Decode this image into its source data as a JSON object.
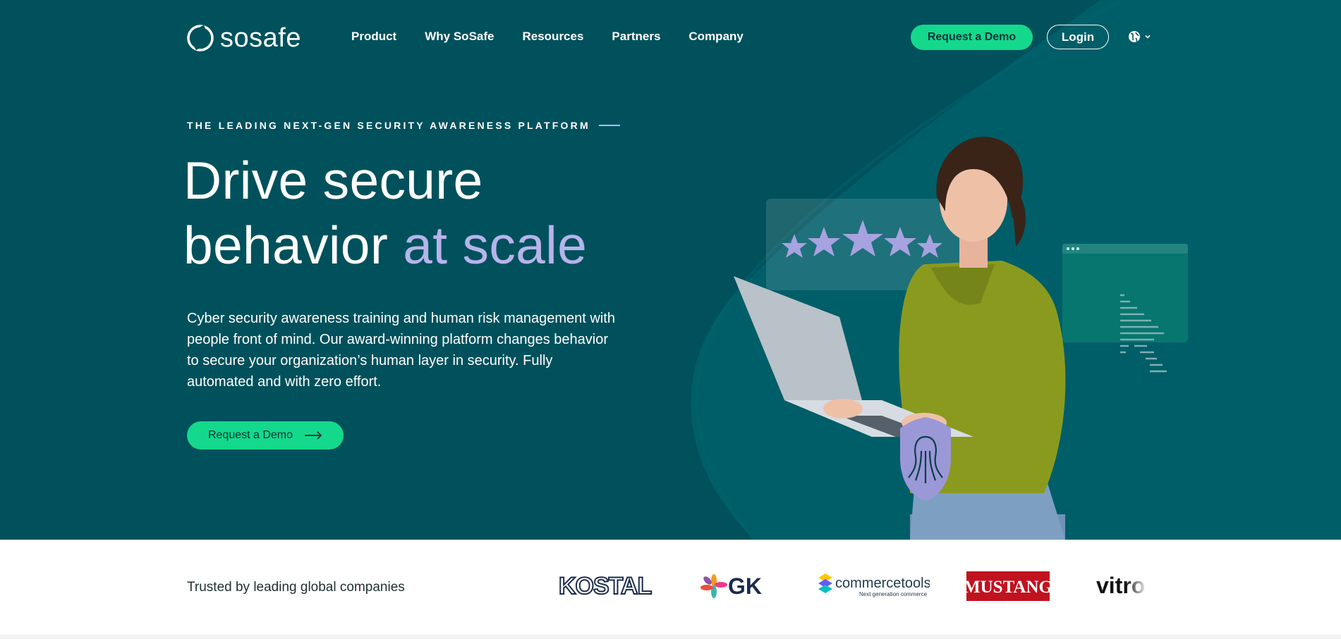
{
  "brand": {
    "name": "sosafe"
  },
  "nav": {
    "links": [
      {
        "label": "Product"
      },
      {
        "label": "Why SoSafe"
      },
      {
        "label": "Resources"
      },
      {
        "label": "Partners"
      },
      {
        "label": "Company"
      }
    ],
    "demo_label": "Request a Demo",
    "login_label": "Login",
    "language_icon": "globe-icon"
  },
  "hero": {
    "eyebrow": "THE LEADING NEXT-GEN SECURITY AWARENESS PLATFORM",
    "headline_line1": "Drive secure",
    "headline_line2_plain": "behavior ",
    "headline_line2_accent": "at scale",
    "description": "Cyber security awareness training and human risk management with people front of mind. Our award-winning platform changes behavior to secure your organization’s human layer in security. Fully automated and with zero effort.",
    "cta_label": "Request a Demo"
  },
  "trusted": {
    "text": "Trusted by leading global companies",
    "logos": [
      "KOSTAL",
      "GK",
      "commercetools",
      "Next generation commerce",
      "MUSTANG",
      "vitro"
    ]
  },
  "colors": {
    "hero_bg": "#00515c",
    "accent_green": "#14d98c",
    "accent_lavender": "#b6b4eb",
    "shield": "#9b98d8"
  }
}
